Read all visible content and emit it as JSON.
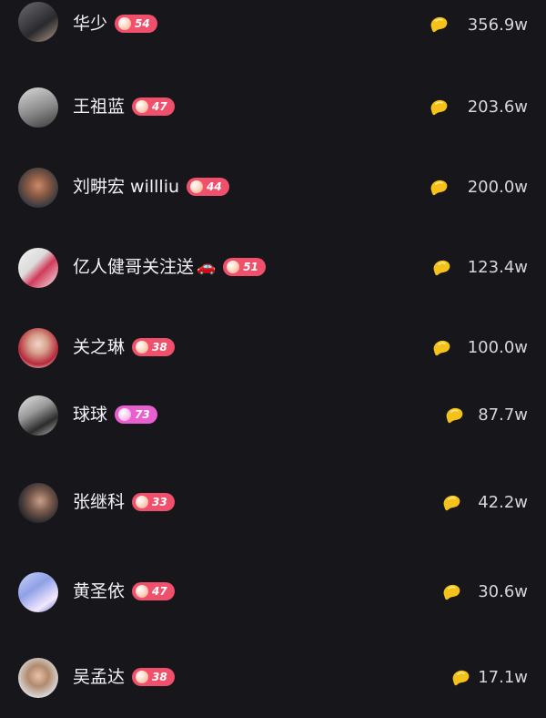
{
  "colors": {
    "background": "#17161b",
    "bean": "#f4c21b",
    "badge_red": "#f0506b",
    "badge_pink": "#e85fcf"
  },
  "icons": {
    "bean": "gold-bean-icon",
    "badge": "level-gem-icon",
    "car": "car-emoji-icon"
  },
  "rows": [
    {
      "name": "华少",
      "level": "54",
      "level_color": "#f0506b",
      "amount": "356.9w",
      "car": ""
    },
    {
      "name": "王祖蓝",
      "level": "47",
      "level_color": "#f0506b",
      "amount": "203.6w",
      "car": ""
    },
    {
      "name": "刘畊宏 willliu",
      "level": "44",
      "level_color": "#f0506b",
      "amount": "200.0w",
      "car": ""
    },
    {
      "name": "亿人健哥关注送",
      "level": "51",
      "level_color": "#f0506b",
      "amount": "123.4w",
      "car": "🚗"
    },
    {
      "name": "关之琳",
      "level": "38",
      "level_color": "#f0506b",
      "amount": "100.0w",
      "car": ""
    },
    {
      "name": "球球",
      "level": "73",
      "level_color": "#e85fcf",
      "amount": "87.7w",
      "car": ""
    },
    {
      "name": "张继科",
      "level": "33",
      "level_color": "#f0506b",
      "amount": "42.2w",
      "car": ""
    },
    {
      "name": "黄圣依",
      "level": "47",
      "level_color": "#f0506b",
      "amount": "30.6w",
      "car": ""
    },
    {
      "name": "吴孟达",
      "level": "38",
      "level_color": "#f0506b",
      "amount": "17.1w",
      "car": ""
    }
  ]
}
